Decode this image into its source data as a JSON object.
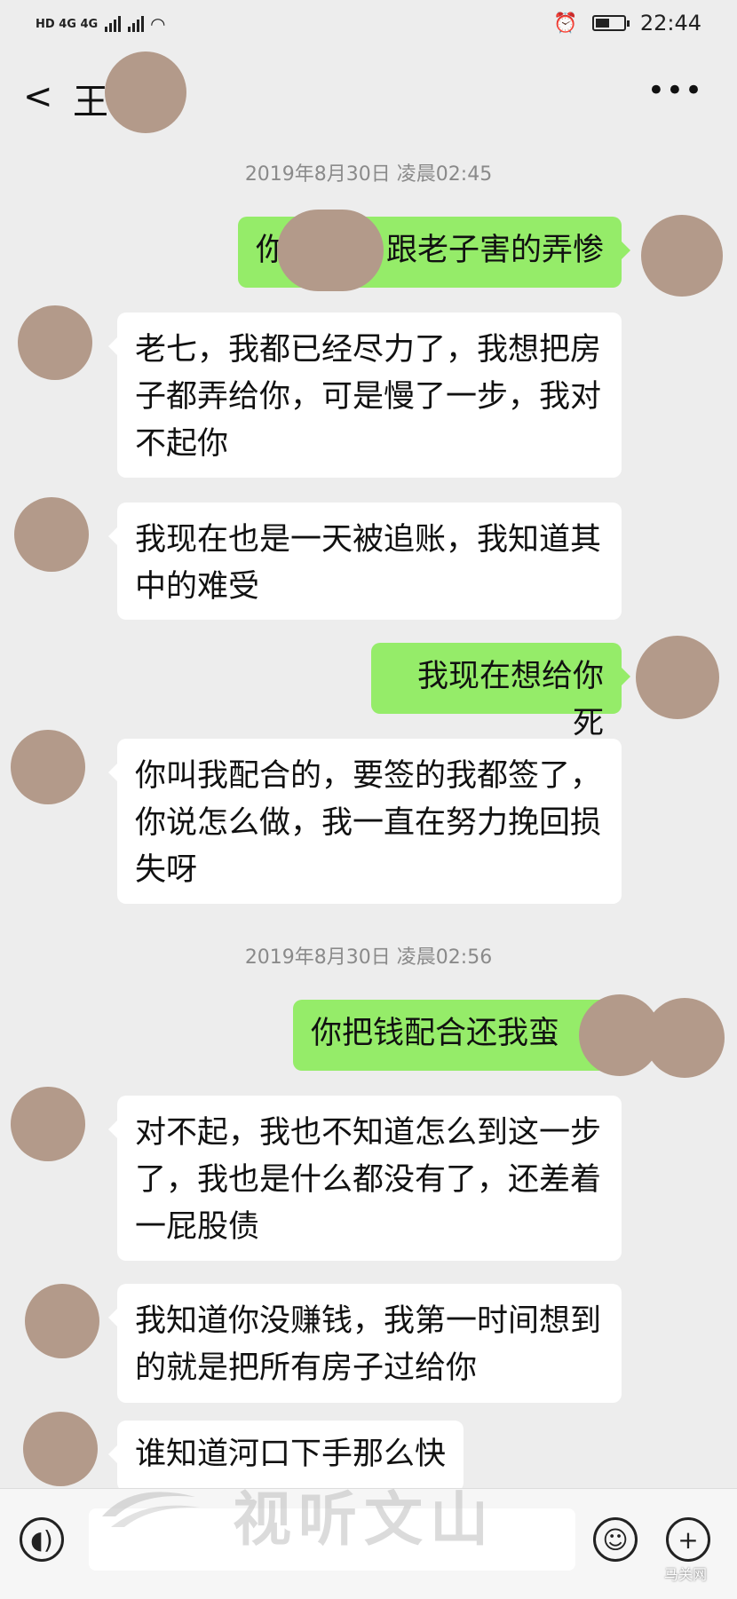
{
  "status_bar": {
    "left": "HD 4G 4G",
    "time": "22:44",
    "battery_level": 0.5
  },
  "header": {
    "title": "王",
    "back_icon": "chevron-left-icon",
    "more_icon": "more-dots-icon"
  },
  "messages": {
    "ts1": "2019年8月30日 凌晨02:45",
    "m1_left": "你",
    "m1_right": "跟老子害的弄惨",
    "m2": "老七，我都已经尽力了，我想把房子都弄给你，可是慢了一步，我对不起你",
    "m3": "我现在也是一天被追账，我知道其中的难受",
    "m4": "我现在想给你死",
    "m5": "你叫我配合的，要签的我都签了，你说怎么做，我一直在努力挽回损失呀",
    "ts2": "2019年8月30日 凌晨02:56",
    "m6": "你把钱配合还我蛮",
    "m7": "对不起，我也不知道怎么到这一步了，我也是什么都没有了，还差着一屁股债",
    "m8": "我知道你没赚钱，我第一时间想到的就是把所有房子过给你",
    "m9": "谁知道河口下手那么快"
  },
  "watermark": {
    "text": "视听文山",
    "corner": "马关网"
  },
  "input_bar": {
    "voice_icon": "voice-icon",
    "emoji_icon": "emoji-icon",
    "plus_icon": "plus-icon"
  }
}
